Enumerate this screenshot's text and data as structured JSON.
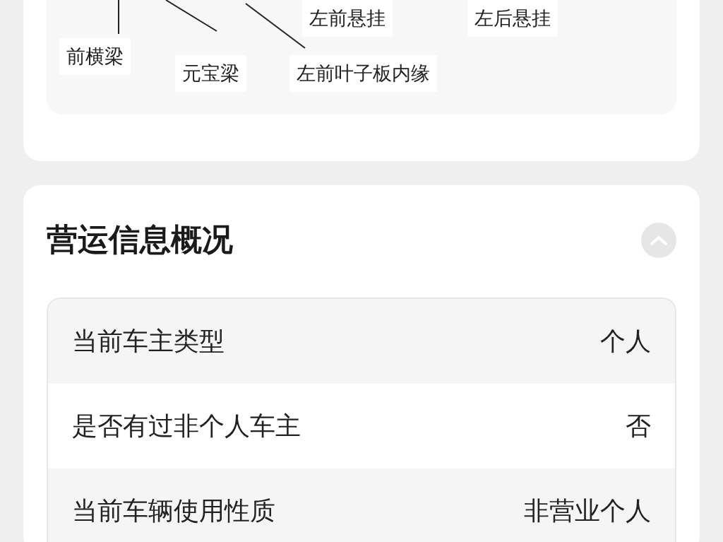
{
  "diagram": {
    "labels": [
      "左前悬挂",
      "左后悬挂",
      "前横梁",
      "元宝梁",
      "左前叶子板内缘"
    ]
  },
  "operation_card": {
    "title": "营运信息概况",
    "expanded": true,
    "rows": [
      {
        "label": "当前车主类型",
        "value": "个人"
      },
      {
        "label": "是否有过非个人车主",
        "value": "否"
      },
      {
        "label": "当前车辆使用性质",
        "value": "非营业个人"
      }
    ]
  }
}
